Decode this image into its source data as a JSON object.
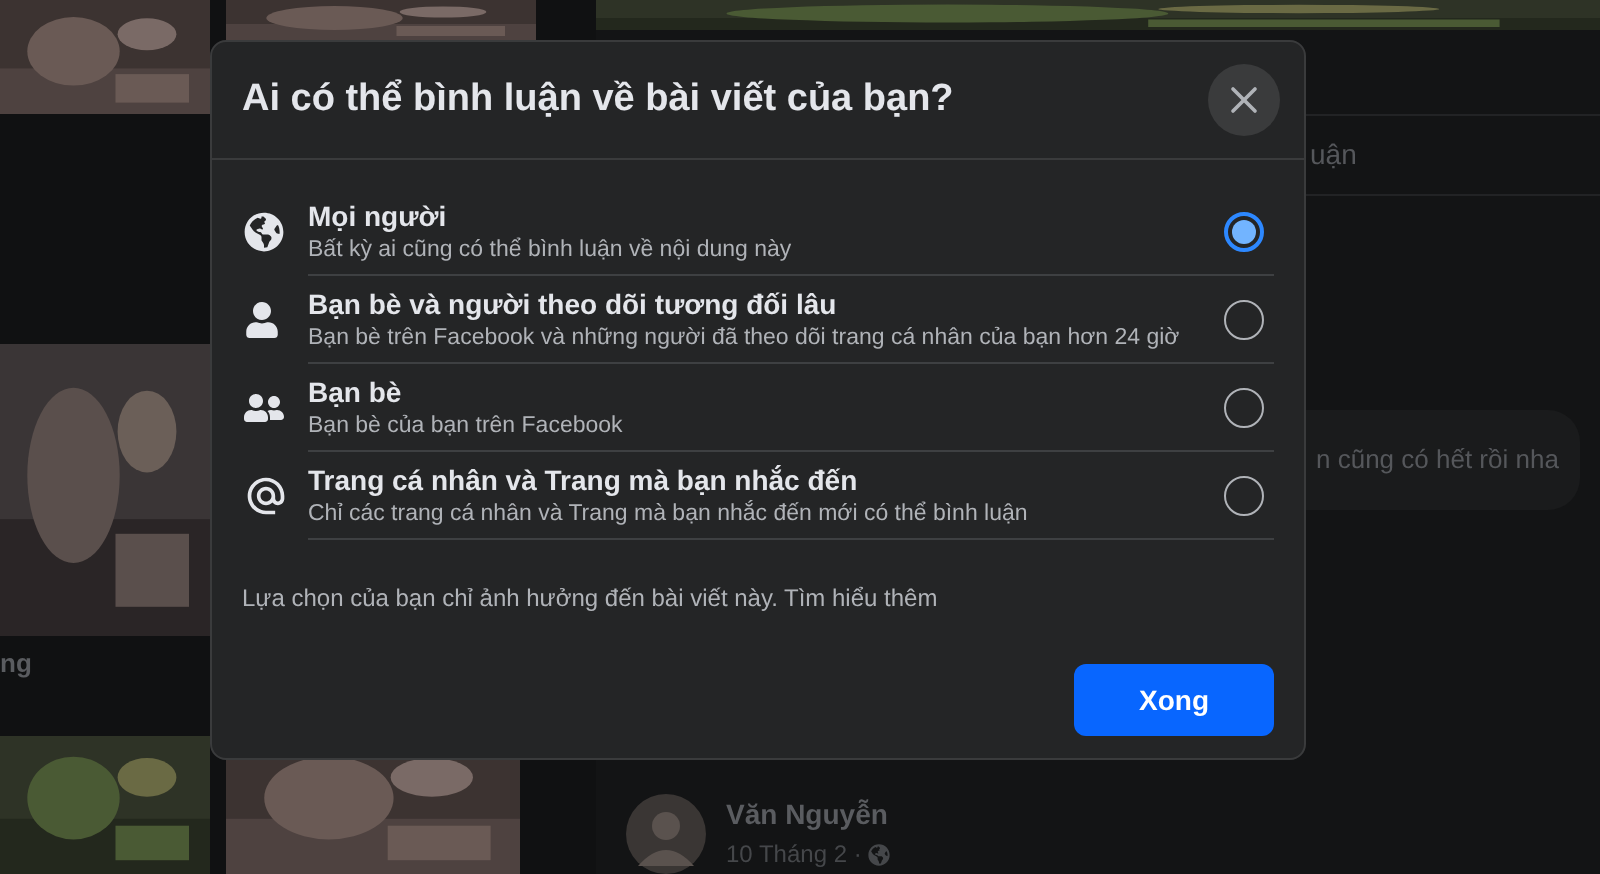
{
  "dialog": {
    "title": "Ai có thể bình luận về bài viết của bạn?",
    "options": [
      {
        "kind": "globe",
        "label": "Mọi người",
        "description": "Bất kỳ ai cũng có thể bình luận về nội dung này",
        "selected": true
      },
      {
        "kind": "person",
        "label": "Bạn bè và người theo dõi tương đối lâu",
        "description": "Bạn bè trên Facebook và những người đã theo dõi trang cá nhân của bạn hơn 24 giờ",
        "selected": false
      },
      {
        "kind": "people",
        "label": "Bạn bè",
        "description": "Bạn bè của bạn trên Facebook",
        "selected": false
      },
      {
        "kind": "at",
        "label": "Trang cá nhân và Trang mà bạn nhắc đến",
        "description": "Chỉ các trang cá nhân và Trang mà bạn nhắc đến mới có thể bình luận",
        "selected": false
      }
    ],
    "note": "Lựa chọn của bạn chỉ ảnh hưởng đến bài viết này. Tìm hiểu thêm",
    "done_button": "Xong"
  },
  "background": {
    "photo_caption": "ng",
    "comments_tab": "uận",
    "comment": "n cũng có hết rồi nha",
    "post": {
      "author": "Văn Nguyễn",
      "date": "10 Tháng 2 ·"
    }
  }
}
